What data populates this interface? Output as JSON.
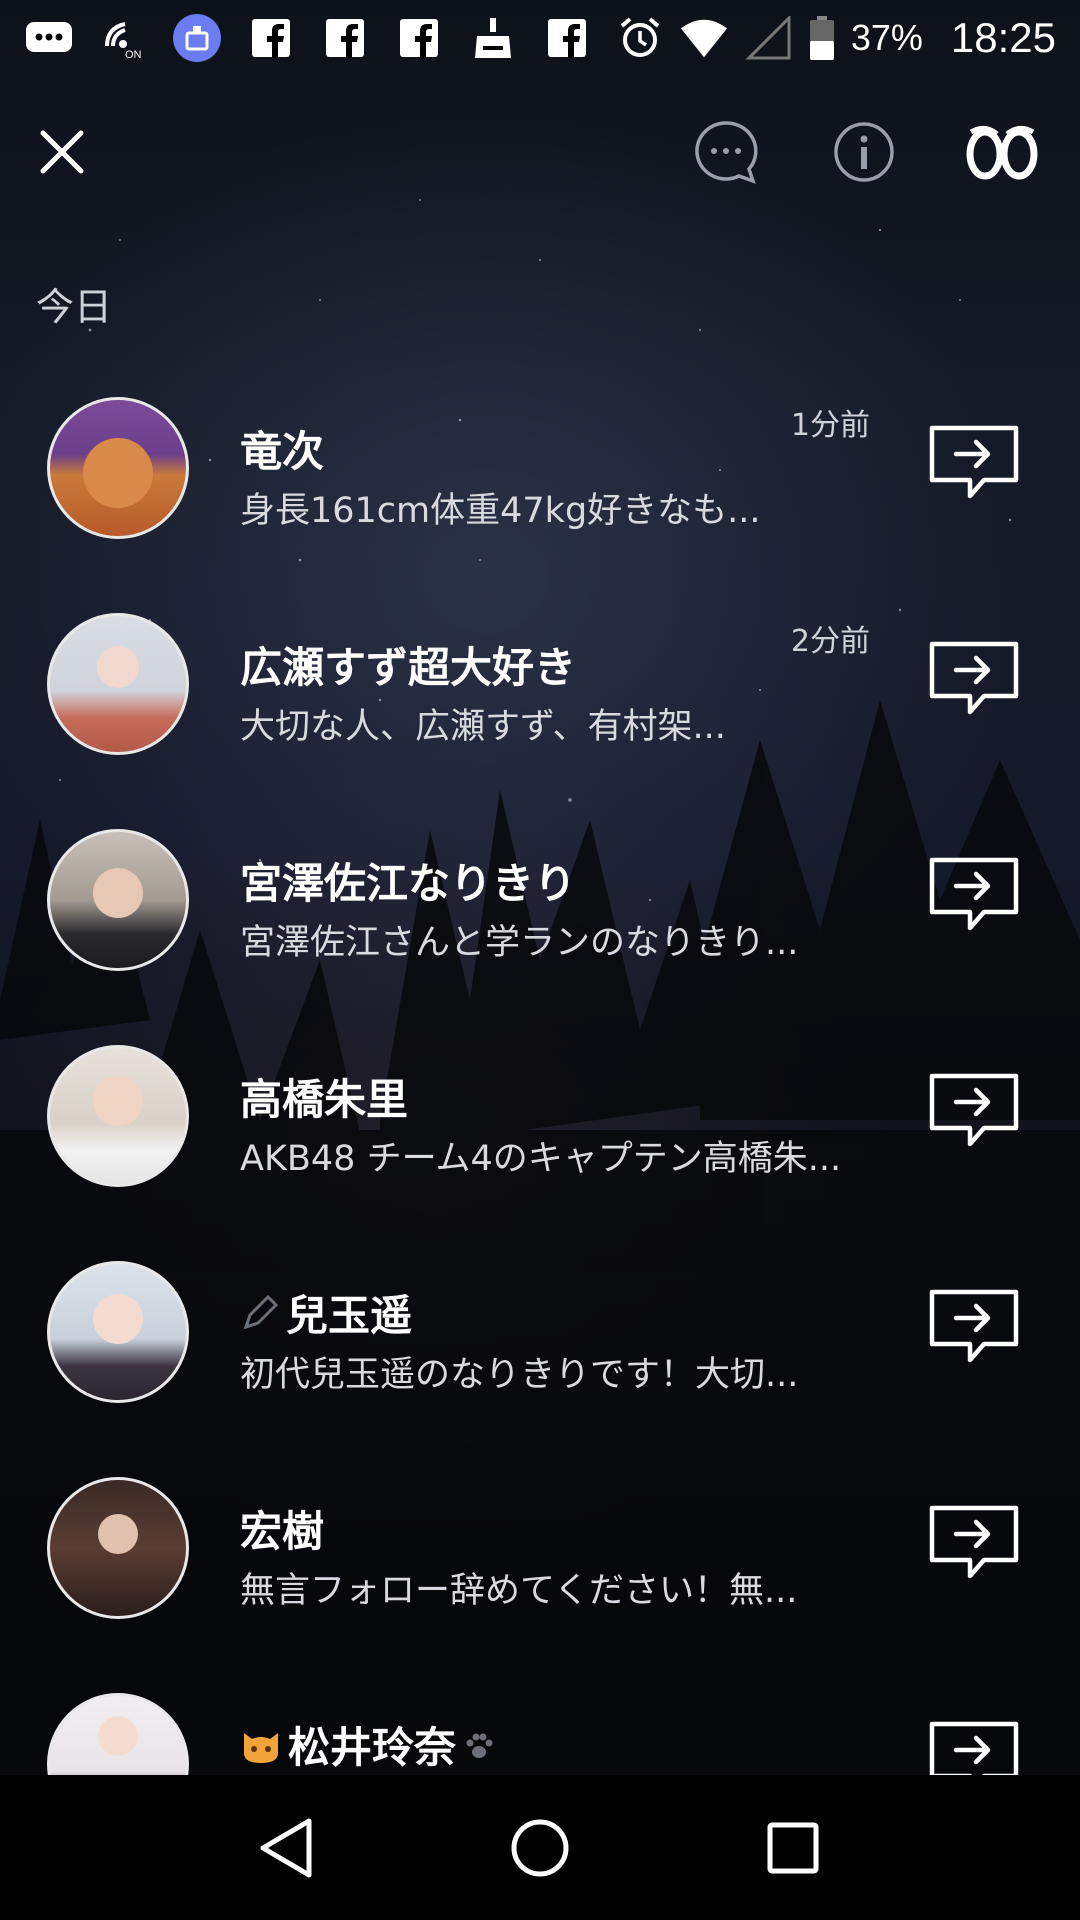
{
  "status_bar": {
    "battery_percent": "37%",
    "time": "18:25",
    "icons": [
      "messages-icon",
      "nfc-on-icon",
      "cleaner-app-icon",
      "facebook-icon",
      "facebook-icon",
      "facebook-icon",
      "broom-icon",
      "facebook-icon",
      "alarm-icon",
      "wifi-icon",
      "cell-signal-icon",
      "battery-icon"
    ]
  },
  "top_bar": {
    "icons": [
      "close-icon",
      "chat-bubble-icon",
      "info-icon",
      "eyes-icon"
    ]
  },
  "section_label": "今日",
  "rows": [
    {
      "name": "竜次",
      "prefix_icon": "",
      "suffix_icon": "",
      "description": "身長161cm体重47kg好きなも...",
      "time": "1分前",
      "avatar": "red-cap-character-avatar"
    },
    {
      "name": "広瀬すず超大好き",
      "prefix_icon": "",
      "suffix_icon": "",
      "description": "大切な人、広瀬すず、有村架...",
      "time": "2分前",
      "avatar": "girl-with-umbrella-avatar"
    },
    {
      "name": "宮澤佐江なりきり",
      "prefix_icon": "",
      "suffix_icon": "",
      "description": "宮澤佐江さんと学ランのなりきり...",
      "time": "",
      "avatar": "person-with-cap-avatar"
    },
    {
      "name": "高橋朱里",
      "prefix_icon": "",
      "suffix_icon": "",
      "description": "AKB48 チーム4のキャプテン高橋朱...",
      "time": "",
      "avatar": "girl-pose-avatar"
    },
    {
      "name": "兒玉遥",
      "prefix_icon": "pencil-icon",
      "suffix_icon": "",
      "description": "初代兒玉遥のなりきりです！大切...",
      "time": "",
      "avatar": "short-hair-girl-avatar"
    },
    {
      "name": "宏樹",
      "prefix_icon": "",
      "suffix_icon": "",
      "description": "無言フォロー辞めてください！無...",
      "time": "",
      "avatar": "dark-poster-avatar"
    },
    {
      "name": "松井玲奈",
      "prefix_icon": "cat-emoji-icon",
      "suffix_icon": "paw-icon",
      "description": "",
      "time": "",
      "avatar": "uniform-girl-avatar"
    }
  ],
  "nav_bar": {
    "icons": [
      "back-triangle-icon",
      "home-circle-icon",
      "recents-square-icon"
    ]
  },
  "colors": {
    "background_top": "#141a26",
    "background_bottom": "#000000",
    "text_primary": "#ffffff",
    "text_secondary": "#d8dae0"
  }
}
